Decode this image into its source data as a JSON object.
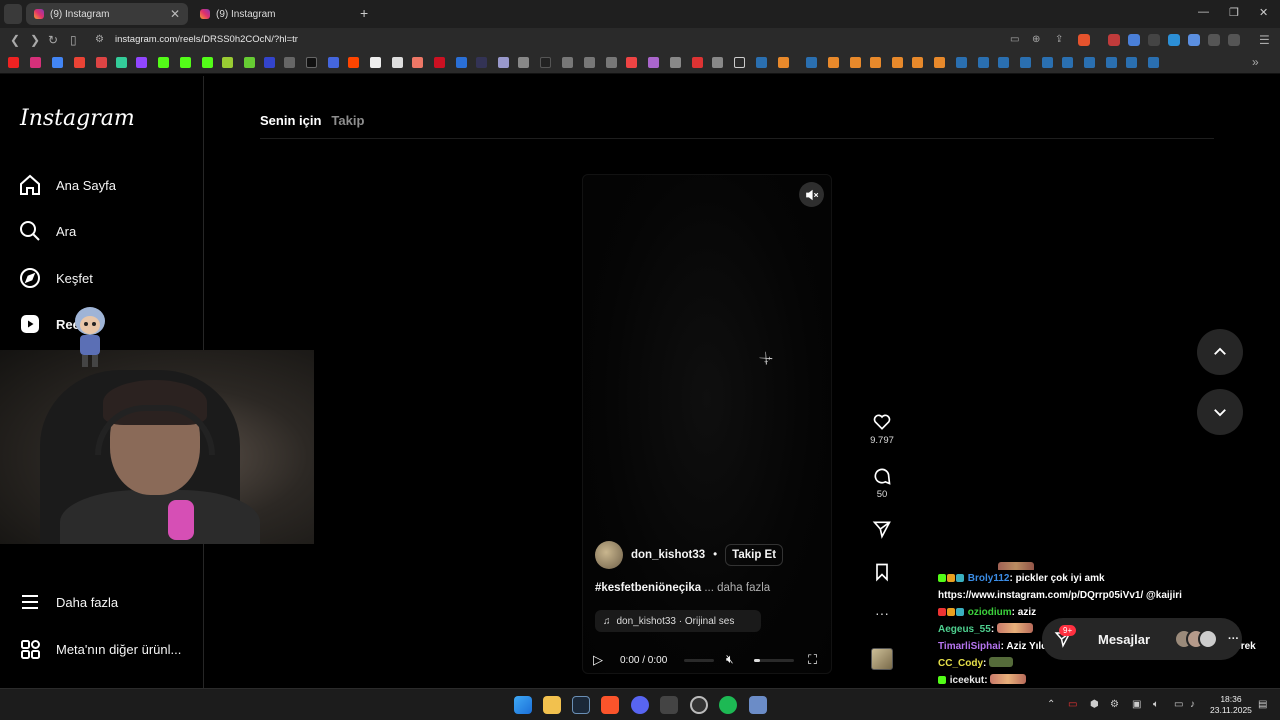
{
  "browser": {
    "tabs": [
      {
        "title": "(9) Instagram",
        "active": true
      },
      {
        "title": "(9) Instagram",
        "active": false
      }
    ],
    "new_tab": "+",
    "url": "instagram.com/reels/DRSS0h2COcN/?hl=tr",
    "window_controls": {
      "minimize": "—",
      "maximize": "❐",
      "close": "✕"
    }
  },
  "instagram": {
    "logo": "Instagram",
    "nav": [
      {
        "label": "Ana Sayfa",
        "icon": "home-icon"
      },
      {
        "label": "Ara",
        "icon": "search-icon"
      },
      {
        "label": "Keşfet",
        "icon": "compass-icon"
      },
      {
        "label": "Ree",
        "icon": "reels-icon"
      }
    ],
    "bottom_nav": [
      {
        "label": "Daha fazla",
        "icon": "menu-icon"
      },
      {
        "label": "Meta'nın diğer ürünl...",
        "icon": "meta-apps-icon"
      }
    ],
    "feed_tabs": [
      {
        "label": "Senin için",
        "active": true
      },
      {
        "label": "Takip",
        "active": false
      }
    ],
    "reel": {
      "author": "don_kishot33",
      "separator": "•",
      "follow_label": "Takip Et",
      "caption": "#kesfetbeniöneçika",
      "caption_more": "... daha fazla",
      "audio": "don_kishot33 · Orijinal ses",
      "time": "0:00 / 0:00",
      "likes": "9.797",
      "comments": "50"
    },
    "messages": {
      "label": "Mesajlar",
      "badge": "9+",
      "more": "···"
    }
  },
  "chat": [
    {
      "user": "Broly112",
      "user_color": "#3b8de6",
      "text": ": pickler çok iyi amk"
    },
    {
      "user": "",
      "user_color": "#ffffff",
      "text": "https://www.instagram.com/p/DQrrp05iVv1/ @kaijiri"
    },
    {
      "user": "oziodium",
      "user_color": "#3cd23c",
      "text": ": aziz"
    },
    {
      "user": "Aegeus_55",
      "user_color": "#4ed08f",
      "text": ":"
    },
    {
      "user": "TimarliSiphai",
      "user_color": "#b675f0",
      "text": ": Aziz Yıldırımın böyle ara ara gündeme gelmesi gerek"
    },
    {
      "user": "CC_Cody",
      "user_color": "#e6e04a",
      "text": ":"
    },
    {
      "user": "iceekut",
      "user_color": "#e8e8e8",
      "text": ":"
    }
  ],
  "taskbar": {
    "time": "18:36",
    "date": "23.11.2025"
  },
  "colors": {
    "accent": "#0095f6",
    "badge": "#ff3040"
  }
}
